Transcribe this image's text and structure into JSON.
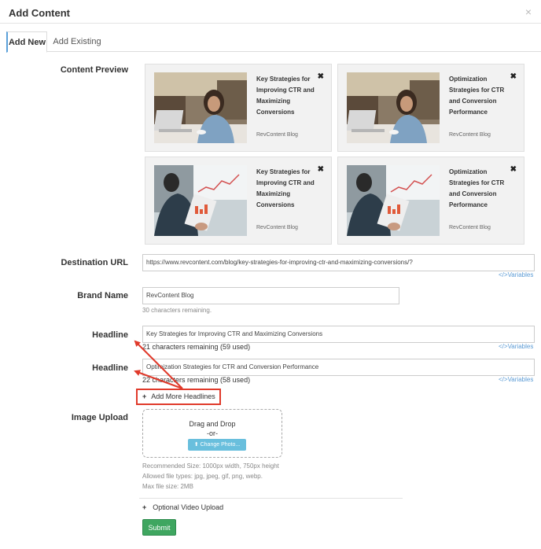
{
  "modal": {
    "title": "Add Content",
    "close_glyph": "×"
  },
  "tabs": [
    {
      "label": "Add New",
      "active": true
    },
    {
      "label": "Add Existing",
      "active": false
    }
  ],
  "content_preview": {
    "label": "Content Preview",
    "cards": [
      {
        "title": "Key Strategies for Improving CTR and Maximizing Conversions",
        "brand": "RevContent Blog",
        "image": "woman-laptop-cafe"
      },
      {
        "title": "Optimization Strategies for CTR and Conversion Performance",
        "brand": "RevContent Blog",
        "image": "woman-laptop-cafe"
      },
      {
        "title": "Key Strategies for Improving CTR and Maximizing Conversions",
        "brand": "RevContent Blog",
        "image": "tablet-analytics"
      },
      {
        "title": "Optimization Strategies for CTR and Conversion Performance",
        "brand": "RevContent Blog",
        "image": "tablet-analytics"
      }
    ],
    "remove_glyph": "✖"
  },
  "destination": {
    "label": "Destination URL",
    "value": "https://www.revcontent.com/blog/key-strategies-for-improving-ctr-and-maximizing-conversions/?",
    "variables": "</>Variables"
  },
  "brand": {
    "label": "Brand Name",
    "value": "RevContent Blog",
    "helper": "30 characters remaining."
  },
  "headline1": {
    "label": "Headline",
    "value": "Key Strategies for Improving CTR and Maximizing Conversions",
    "counter": "21 characters remaining (59 used)",
    "variables": "</>Variables"
  },
  "headline2": {
    "label": "Headline",
    "value": "Optimization Strategies for CTR and Conversion Performance",
    "counter": "22 characters remaining (58 used)",
    "variables": "</>Variables"
  },
  "add_more": {
    "plus": "+",
    "label": "Add More Headlines"
  },
  "image_upload": {
    "label": "Image Upload",
    "drag": "Drag and Drop",
    "or": "-or-",
    "button": "Change Photo...",
    "button_icon": "upload-icon",
    "recommended": "Recommended Size: 1000px width, 750px height",
    "allowed": "Allowed file types: jpg, jpeg, gif, png, webp.",
    "max": "Max file size: 2MB"
  },
  "video": {
    "plus": "+",
    "label": "Optional Video Upload"
  },
  "submit": {
    "label": "Submit"
  },
  "colors": {
    "accent_red": "#e03a2b",
    "submit_green": "#3fa660",
    "link_blue": "#5b9bd5",
    "button_blue": "#69bfdd"
  }
}
